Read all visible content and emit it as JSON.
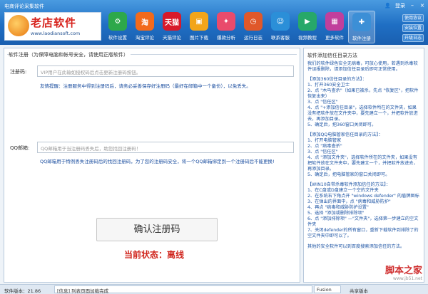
{
  "app": {
    "title": "电商评论采集软件",
    "logo_text": "老店软件",
    "logo_url": "www.laodiansoft.com",
    "login_label": "登录",
    "window_controls": [
      "minimize-icon",
      "close-icon"
    ]
  },
  "toolbar": [
    {
      "label": "软件设置",
      "icon": "gear-icon",
      "color": "#2da84a",
      "glyph": "⚙"
    },
    {
      "label": "淘宝评论",
      "icon": "taobao-icon",
      "color": "#f26a1b",
      "glyph": "淘"
    },
    {
      "label": "天猫评论",
      "icon": "tmall-icon",
      "color": "#d8192a",
      "glyph": "天猫"
    },
    {
      "label": "图片下载",
      "icon": "image-download-icon",
      "color": "#f2a51a",
      "glyph": "▣"
    },
    {
      "label": "爆款分析",
      "icon": "hot-analysis-icon",
      "color": "#e94b6c",
      "glyph": "✦"
    },
    {
      "label": "运行日志",
      "icon": "log-icon",
      "color": "#e0582a",
      "glyph": "◷"
    },
    {
      "label": "联系客服",
      "icon": "support-icon",
      "color": "#2b8fd8",
      "glyph": "☺"
    },
    {
      "label": "视频教程",
      "icon": "video-icon",
      "color": "#27a86a",
      "glyph": "▶"
    },
    {
      "label": "更多软件",
      "icon": "more-software-icon",
      "color": "#c13f9c",
      "glyph": "▦"
    },
    {
      "label": "软件注册",
      "icon": "register-icon",
      "color": "#3c8fd6",
      "glyph": "✚"
    }
  ],
  "side_buttons": [
    "使用协议",
    "安装位置",
    "升级日志"
  ],
  "register": {
    "group_title": "软件注册（为保障电脑和帐号安全，请使用正版软件）",
    "code_label": "注册码:",
    "code_placeholder": "VIP用户在此输如授权码后点击更新注册码按钮。",
    "code_note": "友情提醒：注册服务中得到注册码后，请务必妥善保存好注册码（最好在邮箱中一个备份），以免丢失。",
    "email_label": "QQ邮箱:",
    "email_placeholder": "QQ邮箱用于当注册码丢失后，助您找回注册码！",
    "email_note": "QQ邮箱用于特例丢失注册码后的找回注册码，为了您的注册码安全，将一个QQ邮箱绑定到一个注册码后不能更换!",
    "confirm_label": "确认注册码",
    "status_label": "当前状态：",
    "status_value": "离线"
  },
  "trust_panel": {
    "title": "软件添加信任目录方法",
    "intro": "我们的软件绿色安全无病毒，可放心使用，若遇到杀毒软件误报删除，请添加信任目录后即可正常使用。",
    "sections": [
      {
        "heading": "【添加360信任目录的方法】：",
        "lines": [
          "1、打开360安全卫士",
          "2、点 \"木马查杀\"（如果已被杀，先点 \"恢复区\"，把软件恢复出来）",
          "3、点 \"信任区\"",
          "4、点 \"+添加信任目录\"，选择软件所在的文件夹，如果没有把软件放在文件夹中，要先建立一个，并把软件放进去，再添加目录。",
          "5、确定后，把360窗口关闭即可。"
        ]
      },
      {
        "heading": "【添加QQ电脑管家信任目录的方法】：",
        "lines": [
          "1、打开电脑管家",
          "2、点 \"病毒查杀\"",
          "3、点 \"信任区\"",
          "4、点 \"添加文件夹\"，选择软件所在的文件夹，如果没有把软件放在文件夹中，要先建立一个，并把软件放进去，再添加目录。",
          "5、确定后，把电脑管家的窗口关闭即可。"
        ]
      },
      {
        "heading": "【WIN10自带杀毒软件添加信任的方法】：",
        "lines": [
          "1、在C盘或D盘建立一个空的文件夹",
          "2、在系统右下角点开 \"windows defender\" 的盾牌图标",
          "3、在弹出的界面中，点 \"病毒和威胁防护\"",
          "4、再点 \"病毒和威胁防护设置\"",
          "5、选择 \"添加或删除排除项\"",
          "6、点 \"添加排除项\" —\"文件夹\"，选择第一步建立的空文件夹",
          "7、关闭defender的所有窗口，重新下载软件到排除了的空文件夹中即可以了。"
        ]
      }
    ],
    "footer": "其他的安全软件可以到百度搜索添加信任的方法。"
  },
  "watermark": {
    "main": "脚本之家",
    "url": "www.jb51.net"
  },
  "statusbar": {
    "version": "软件版本：21.86",
    "message": "[信息] 列表页面加载完成",
    "select_value": "Fusion",
    "shared_label": "共享版本"
  }
}
